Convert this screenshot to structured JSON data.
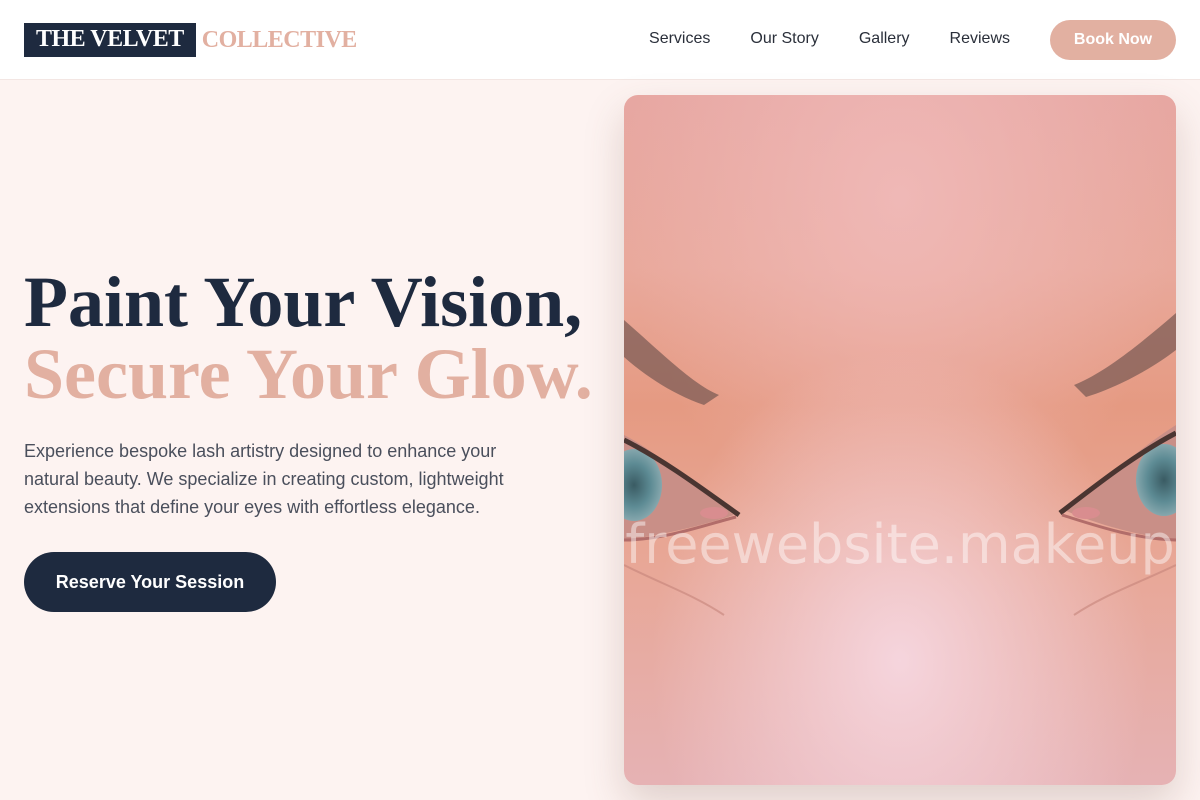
{
  "brand": {
    "name_dark": "THE VELVET",
    "name_light": "COLLECTIVE"
  },
  "nav": {
    "items": [
      {
        "label": "Services"
      },
      {
        "label": "Our Story"
      },
      {
        "label": "Gallery"
      },
      {
        "label": "Reviews"
      }
    ],
    "cta_label": "Book Now"
  },
  "hero": {
    "title_line1": "Paint Your Vision,",
    "title_line2": "Secure Your Glow.",
    "description": "Experience bespoke lash artistry designed to enhance your natural beauty. We specialize in creating custom, lightweight extensions that define your eyes with effortless elegance.",
    "cta_label": "Reserve Your Session"
  },
  "image": {
    "watermark": "freewebsite.makeup"
  },
  "colors": {
    "navy": "#1e2a3f",
    "blush": "#e2b0a1",
    "background": "#fdf3f1"
  }
}
